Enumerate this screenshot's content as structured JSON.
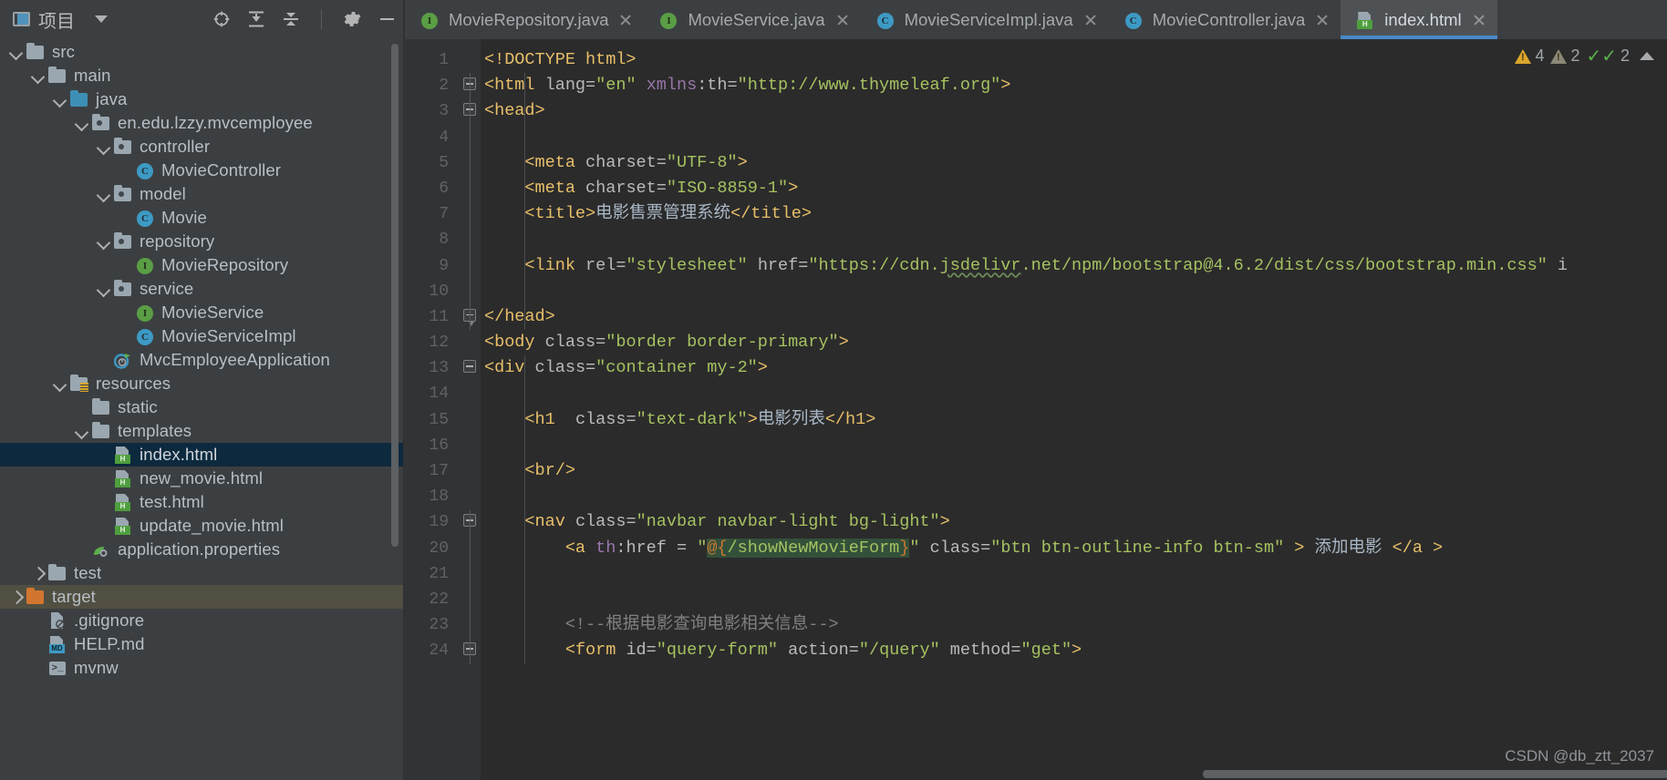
{
  "project_panel": {
    "title": "项目",
    "icons": {
      "window": "project-window-icon",
      "caret": "chevron-down-icon",
      "locate": "locate-target-icon",
      "expand_all": "expand-all-icon",
      "collapse_all": "collapse-all-icon",
      "settings": "gear-icon",
      "hide": "minimize-icon"
    },
    "tree": [
      {
        "label": "src",
        "indent": 1,
        "arrow": "down",
        "icon": "folder-gray",
        "state": "normal"
      },
      {
        "label": "main",
        "indent": 2,
        "arrow": "down",
        "icon": "folder-gray",
        "state": "normal"
      },
      {
        "label": "java",
        "indent": 3,
        "arrow": "down",
        "icon": "folder-blue",
        "state": "normal"
      },
      {
        "label": "en.edu.lzzy.mvcemployee",
        "indent": 4,
        "arrow": "down",
        "icon": "folder-package",
        "state": "normal"
      },
      {
        "label": "controller",
        "indent": 5,
        "arrow": "down",
        "icon": "folder-package",
        "state": "normal"
      },
      {
        "label": "MovieController",
        "indent": 6,
        "arrow": "none",
        "icon": "class-icon",
        "state": "normal"
      },
      {
        "label": "model",
        "indent": 5,
        "arrow": "down",
        "icon": "folder-package",
        "state": "normal"
      },
      {
        "label": "Movie",
        "indent": 6,
        "arrow": "none",
        "icon": "class-icon",
        "state": "normal"
      },
      {
        "label": "repository",
        "indent": 5,
        "arrow": "down",
        "icon": "folder-package",
        "state": "normal"
      },
      {
        "label": "MovieRepository",
        "indent": 6,
        "arrow": "none",
        "icon": "interface-icon",
        "state": "normal"
      },
      {
        "label": "service",
        "indent": 5,
        "arrow": "down",
        "icon": "folder-package",
        "state": "normal"
      },
      {
        "label": "MovieService",
        "indent": 6,
        "arrow": "none",
        "icon": "interface-icon",
        "state": "normal"
      },
      {
        "label": "MovieServiceImpl",
        "indent": 6,
        "arrow": "none",
        "icon": "class-icon",
        "state": "normal"
      },
      {
        "label": "MvcEmployeeApplication",
        "indent": 5,
        "arrow": "none",
        "icon": "spring-boot-icon",
        "state": "normal"
      },
      {
        "label": "resources",
        "indent": 3,
        "arrow": "down",
        "icon": "folder-resources",
        "state": "normal"
      },
      {
        "label": "static",
        "indent": 4,
        "arrow": "none",
        "icon": "folder-gray",
        "state": "normal"
      },
      {
        "label": "templates",
        "indent": 4,
        "arrow": "down",
        "icon": "folder-gray",
        "state": "normal"
      },
      {
        "label": "index.html",
        "indent": 5,
        "arrow": "none",
        "icon": "html-file-icon",
        "state": "selected"
      },
      {
        "label": "new_movie.html",
        "indent": 5,
        "arrow": "none",
        "icon": "html-file-icon",
        "state": "normal"
      },
      {
        "label": "test.html",
        "indent": 5,
        "arrow": "none",
        "icon": "html-file-icon",
        "state": "normal"
      },
      {
        "label": "update_movie.html",
        "indent": 5,
        "arrow": "none",
        "icon": "html-file-icon",
        "state": "normal"
      },
      {
        "label": "application.properties",
        "indent": 4,
        "arrow": "none",
        "icon": "properties-icon",
        "state": "normal"
      },
      {
        "label": "test",
        "indent": 2,
        "arrow": "right",
        "icon": "folder-gray",
        "state": "normal"
      },
      {
        "label": "target",
        "indent": 1,
        "arrow": "right",
        "icon": "folder-orange",
        "state": "hovered"
      },
      {
        "label": ".gitignore",
        "indent": 2,
        "arrow": "none",
        "icon": "gitignore-icon",
        "state": "normal"
      },
      {
        "label": "HELP.md",
        "indent": 2,
        "arrow": "none",
        "icon": "md-file-icon",
        "state": "normal"
      },
      {
        "label": "mvnw",
        "indent": 2,
        "arrow": "none",
        "icon": "script-icon",
        "state": "normal"
      }
    ]
  },
  "editor": {
    "tabs": [
      {
        "label": "MovieRepository.java",
        "icon": "interface-icon",
        "active": false
      },
      {
        "label": "MovieService.java",
        "icon": "interface-icon",
        "active": false
      },
      {
        "label": "MovieServiceImpl.java",
        "icon": "class-icon",
        "active": false
      },
      {
        "label": "MovieController.java",
        "icon": "class-icon",
        "active": false
      },
      {
        "label": "index.html",
        "icon": "html-file-icon",
        "active": true
      }
    ],
    "inspections": {
      "warnings": "4",
      "weak_warnings": "2",
      "checks": "2",
      "chevron": "chevron-up-icon"
    },
    "first_line": 1,
    "lines": [
      {
        "n": 1,
        "fold": "none"
      },
      {
        "n": 2,
        "fold": "minus"
      },
      {
        "n": 3,
        "fold": "minus"
      },
      {
        "n": 4,
        "fold": "none"
      },
      {
        "n": 5,
        "fold": "none"
      },
      {
        "n": 6,
        "fold": "none"
      },
      {
        "n": 7,
        "fold": "none"
      },
      {
        "n": 8,
        "fold": "none"
      },
      {
        "n": 9,
        "fold": "none"
      },
      {
        "n": 10,
        "fold": "none"
      },
      {
        "n": 11,
        "fold": "end"
      },
      {
        "n": 12,
        "fold": "none"
      },
      {
        "n": 13,
        "fold": "minus"
      },
      {
        "n": 14,
        "fold": "none"
      },
      {
        "n": 15,
        "fold": "none"
      },
      {
        "n": 16,
        "fold": "none"
      },
      {
        "n": 17,
        "fold": "none"
      },
      {
        "n": 18,
        "fold": "none"
      },
      {
        "n": 19,
        "fold": "minus"
      },
      {
        "n": 20,
        "fold": "none"
      },
      {
        "n": 21,
        "fold": "none"
      },
      {
        "n": 22,
        "fold": "none"
      },
      {
        "n": 23,
        "fold": "none"
      },
      {
        "n": 24,
        "fold": "minus"
      }
    ],
    "code_text": [
      "<!DOCTYPE html>",
      "<html lang=\"en\" xmlns:th=\"http://www.thymeleaf.org\">",
      "<head>",
      "",
      "    <meta charset=\"UTF-8\">",
      "    <meta charset=\"ISO-8859-1\">",
      "    <title>电影售票管理系统</title>",
      "",
      "    <link rel=\"stylesheet\" href=\"https://cdn.jsdelivr.net/npm/bootstrap@4.6.2/dist/css/bootstrap.min.css\" i",
      "",
      "</head>",
      "<body class=\"border border-primary\">",
      "<div class=\"container my-2\">",
      "",
      "    <h1  class=\"text-dark\">电影列表</h1>",
      "",
      "    <br/>",
      "",
      "    <nav class=\"navbar navbar-light bg-light\">",
      "        <a th:href = \"@{/showNewMovieForm}\" class=\"btn btn-outline-info btn-sm\" > 添加电影 </a >",
      "",
      "",
      "        <!--根据电影查询电影相关信息-->",
      "        <form id=\"query-form\" action=\"/query\" method=\"get\">"
    ]
  },
  "watermark": "CSDN @db_ztt_2037"
}
